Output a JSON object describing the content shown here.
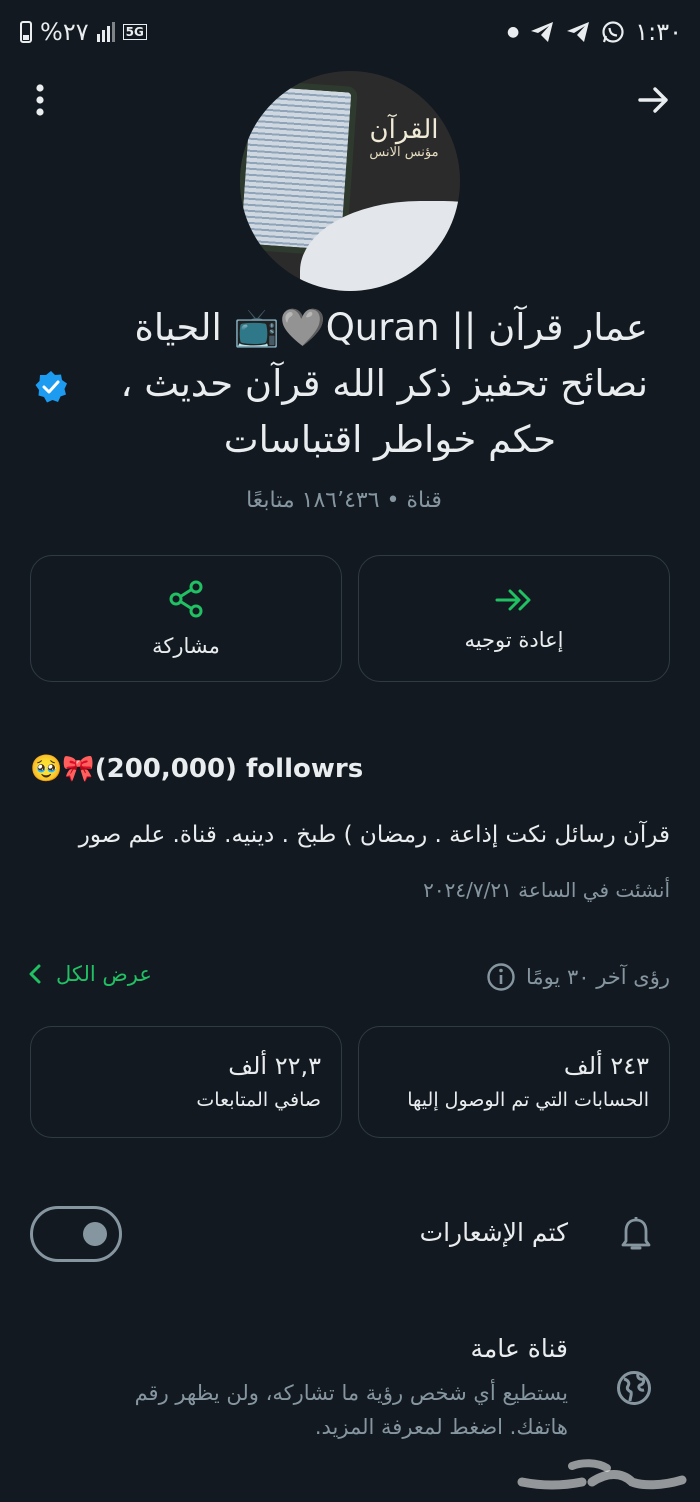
{
  "status_bar": {
    "time": "١:٣٠",
    "battery": "%٢٧",
    "network": "5G"
  },
  "channel": {
    "title_lines": [
      "عمار قرآن || Quran🩶📺 الحياة",
      "نصائح تحفيز ذكر الله قرآن حديث ،",
      "حكم خواطر اقتباسات"
    ],
    "subtitle": "قناة • ١٨٦٬٤٣٦ متابعًا",
    "avatar_text": "القرآن",
    "avatar_subtext": "مؤنس الانس"
  },
  "actions": {
    "forward_label": "إعادة توجيه",
    "share_label": "مشاركة"
  },
  "description": {
    "heading": "🥹🎀(200,000) followrs",
    "body": "قرآن رسائل نكت إذاعة . رمضان ) طبخ . دينيه. قناة. علم صور",
    "created": "أنشئت في الساعة ٢٠٢٤/٧/٢١"
  },
  "insights": {
    "title": "رؤى آخر ٣٠ يومًا",
    "view_all": "عرض الكل",
    "reach_value": "٢٤٣ ألف",
    "reach_caption": "الحسابات التي تم الوصول إليها",
    "net_value": "٢٢,٣ ألف",
    "net_caption": "صافي المتابعات"
  },
  "settings": {
    "mute_label": "كتم الإشعارات",
    "mute_enabled": false,
    "public_title": "قناة عامة",
    "public_desc": "يستطيع أي شخص رؤية ما تشاركه، ولن يظهر رقم هاتفك. اضغط لمعرفة المزيد."
  },
  "colors": {
    "background": "#121920",
    "accent_green": "#21c063",
    "muted_text": "#8696a0",
    "verified_blue": "#1d9bf0"
  }
}
